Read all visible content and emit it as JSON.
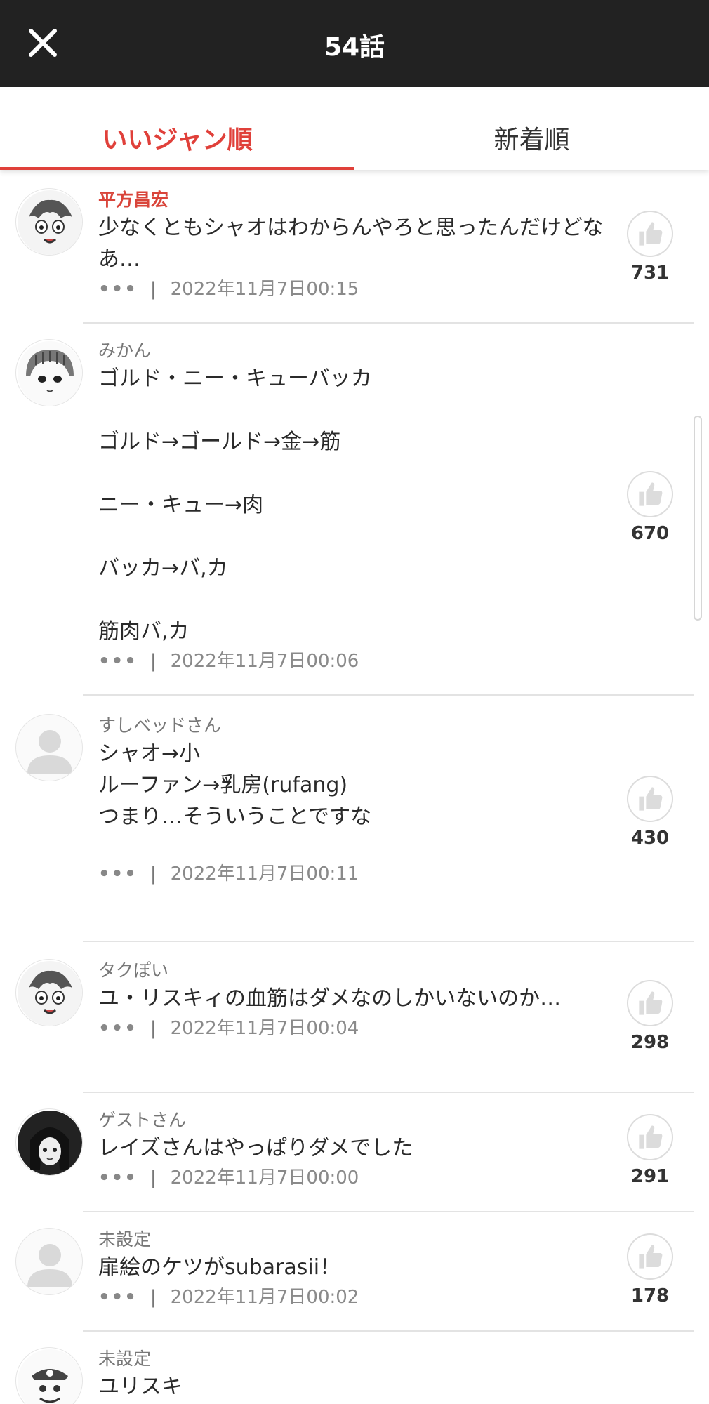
{
  "header": {
    "title": "54話",
    "close_icon": "close-icon"
  },
  "tabs": [
    {
      "label": "いいジャン順",
      "active": true
    },
    {
      "label": "新着順",
      "active": false
    }
  ],
  "colors": {
    "accent": "#e0403a",
    "header_bg": "#222222"
  },
  "comments": [
    {
      "author": "平方昌宏",
      "text": "少なくともシャオはわからんやろと思ったんだけどなあ…",
      "date": "2022年11月7日00:15",
      "likes": "731",
      "more": "•••"
    },
    {
      "author": "みかん",
      "text": "ゴルド・ニー・キューバッカ\n\nゴルド→ゴールド→金→筋\n\nニー・キュー→肉\n\nバッカ→バ,カ\n\n筋肉バ,カ",
      "date": "2022年11月7日00:06",
      "likes": "670",
      "more": "•••"
    },
    {
      "author": "すしベッドさん",
      "text": "シャオ→小\nルーファン→乳房(rufang)\nつまり…そういうことですな",
      "date": "2022年11月7日00:11",
      "likes": "430",
      "more": "•••"
    },
    {
      "author": "タクぽい",
      "text": "ユ・リスキィの血筋はダメなのしかいないのか…",
      "date": "2022年11月7日00:04",
      "likes": "298",
      "more": "•••"
    },
    {
      "author": "ゲストさん",
      "text": "レイズさんはやっぱりダメでした",
      "date": "2022年11月7日00:00",
      "likes": "291",
      "more": "•••"
    },
    {
      "author": "未設定",
      "text": "扉絵のケツがsubarasii！",
      "date": "2022年11月7日00:02",
      "likes": "178",
      "more": "•••"
    },
    {
      "author": "未設定",
      "text": "ユリスキ",
      "date": "",
      "likes": "",
      "more": ""
    }
  ],
  "separator": "|"
}
